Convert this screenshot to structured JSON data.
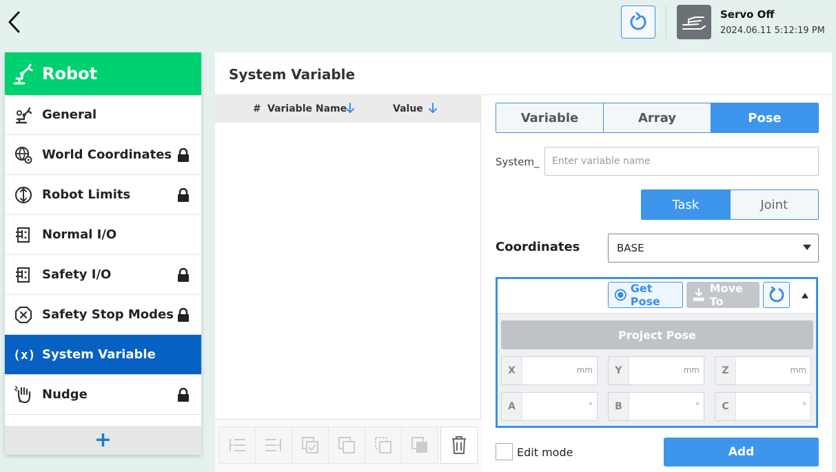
{
  "header": {
    "servo_status": "Servo Off",
    "timestamp": "2024.06.11 5:12:19 PM",
    "accent": "#3b8ee8"
  },
  "sidebar": {
    "title": "Robot",
    "header_color": "#00d170",
    "active_color": "#0661c2",
    "items": [
      {
        "label": "General",
        "icon": "robot-arm-icon",
        "locked": false
      },
      {
        "label": "World Coordinates",
        "icon": "globe-gear-icon",
        "locked": true
      },
      {
        "label": "Robot Limits",
        "icon": "limits-icon",
        "locked": true
      },
      {
        "label": "Normal I/O",
        "icon": "io-icon",
        "locked": false
      },
      {
        "label": "Safety I/O",
        "icon": "io-icon",
        "locked": true
      },
      {
        "label": "Safety Stop Modes",
        "icon": "stop-octagon-icon",
        "locked": true
      },
      {
        "label": "System Variable",
        "icon": "variable-icon",
        "locked": false,
        "active": true
      },
      {
        "label": "Nudge",
        "icon": "hand-icon",
        "locked": true
      }
    ],
    "add_label": "+"
  },
  "main": {
    "title": "System Variable",
    "table": {
      "columns": [
        "#",
        "Variable Name",
        "Value"
      ],
      "rows": []
    },
    "type_tabs": [
      {
        "label": "Variable",
        "active": false
      },
      {
        "label": "Array",
        "active": false
      },
      {
        "label": "Pose",
        "active": true
      }
    ],
    "name_prefix": "System_",
    "name_placeholder": "Enter variable name",
    "name_value": "",
    "space_tabs": [
      {
        "label": "Task",
        "active": true
      },
      {
        "label": "Joint",
        "active": false
      }
    ],
    "coordinates_label": "Coordinates",
    "coordinates_value": "BASE",
    "pose": {
      "get_pose_label": "Get Pose",
      "move_to_label": "Move To",
      "project_pose_label": "Project Pose",
      "fields": [
        {
          "axis": "X",
          "unit": "mm",
          "value": ""
        },
        {
          "axis": "Y",
          "unit": "mm",
          "value": ""
        },
        {
          "axis": "Z",
          "unit": "mm",
          "value": ""
        },
        {
          "axis": "A",
          "unit": "°",
          "value": ""
        },
        {
          "axis": "B",
          "unit": "°",
          "value": ""
        },
        {
          "axis": "C",
          "unit": "°",
          "value": ""
        }
      ]
    },
    "edit_mode_label": "Edit mode",
    "edit_mode_checked": false,
    "add_label": "Add"
  }
}
